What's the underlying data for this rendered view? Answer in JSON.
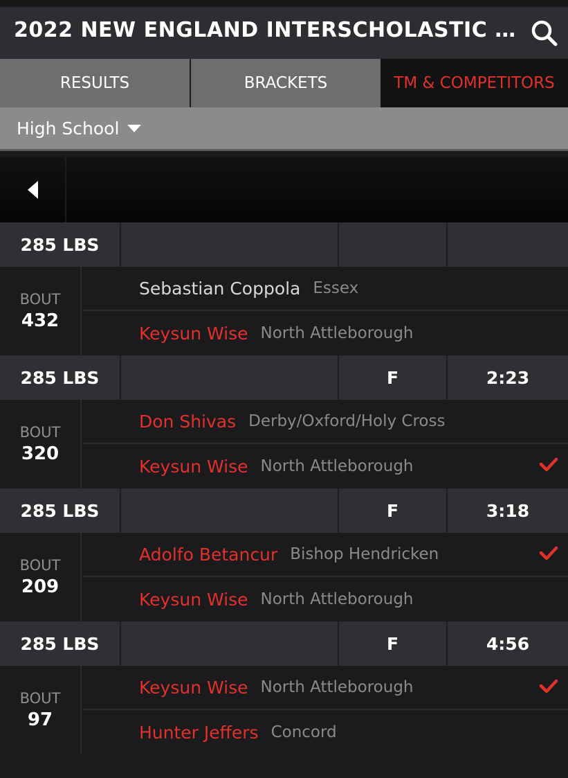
{
  "header": {
    "title": "2022 NEW ENGLAND INTERSCHOLASTIC W...",
    "search_icon": "search-icon"
  },
  "tabs": [
    {
      "label": "RESULTS",
      "active": false
    },
    {
      "label": "BRACKETS",
      "active": false
    },
    {
      "label": "TM & COMPETITORS",
      "active": true
    }
  ],
  "filter": {
    "label": "High School",
    "icon": "caret-down-icon"
  },
  "nav": {
    "back_icon": "back-arrow-icon"
  },
  "colors": {
    "accent_red": "#e2302b",
    "header_bg": "#2d2e31",
    "tab_bg": "#6e6e70"
  },
  "matches": [
    {
      "weight": "285 LBS",
      "result": "",
      "time": "",
      "bout_label": "BOUT",
      "bout_number": "432",
      "wrestlers": [
        {
          "name": "Sebastian Coppola",
          "team": "Essex",
          "highlight": false,
          "winner": false
        },
        {
          "name": "Keysun Wise",
          "team": "North Attleborough",
          "highlight": true,
          "winner": false
        }
      ]
    },
    {
      "weight": "285 LBS",
      "result": "F",
      "time": "2:23",
      "bout_label": "BOUT",
      "bout_number": "320",
      "wrestlers": [
        {
          "name": "Don Shivas",
          "team": "Derby/Oxford/Holy Cross",
          "highlight": true,
          "winner": false
        },
        {
          "name": "Keysun Wise",
          "team": "North Attleborough",
          "highlight": true,
          "winner": true
        }
      ]
    },
    {
      "weight": "285 LBS",
      "result": "F",
      "time": "3:18",
      "bout_label": "BOUT",
      "bout_number": "209",
      "wrestlers": [
        {
          "name": "Adolfo Betancur",
          "team": "Bishop Hendricken",
          "highlight": true,
          "winner": true
        },
        {
          "name": "Keysun Wise",
          "team": "North Attleborough",
          "highlight": true,
          "winner": false
        }
      ]
    },
    {
      "weight": "285 LBS",
      "result": "F",
      "time": "4:56",
      "bout_label": "BOUT",
      "bout_number": "97",
      "wrestlers": [
        {
          "name": "Keysun Wise",
          "team": "North Attleborough",
          "highlight": true,
          "winner": true
        },
        {
          "name": "Hunter Jeffers",
          "team": "Concord",
          "highlight": true,
          "winner": false
        }
      ]
    }
  ]
}
